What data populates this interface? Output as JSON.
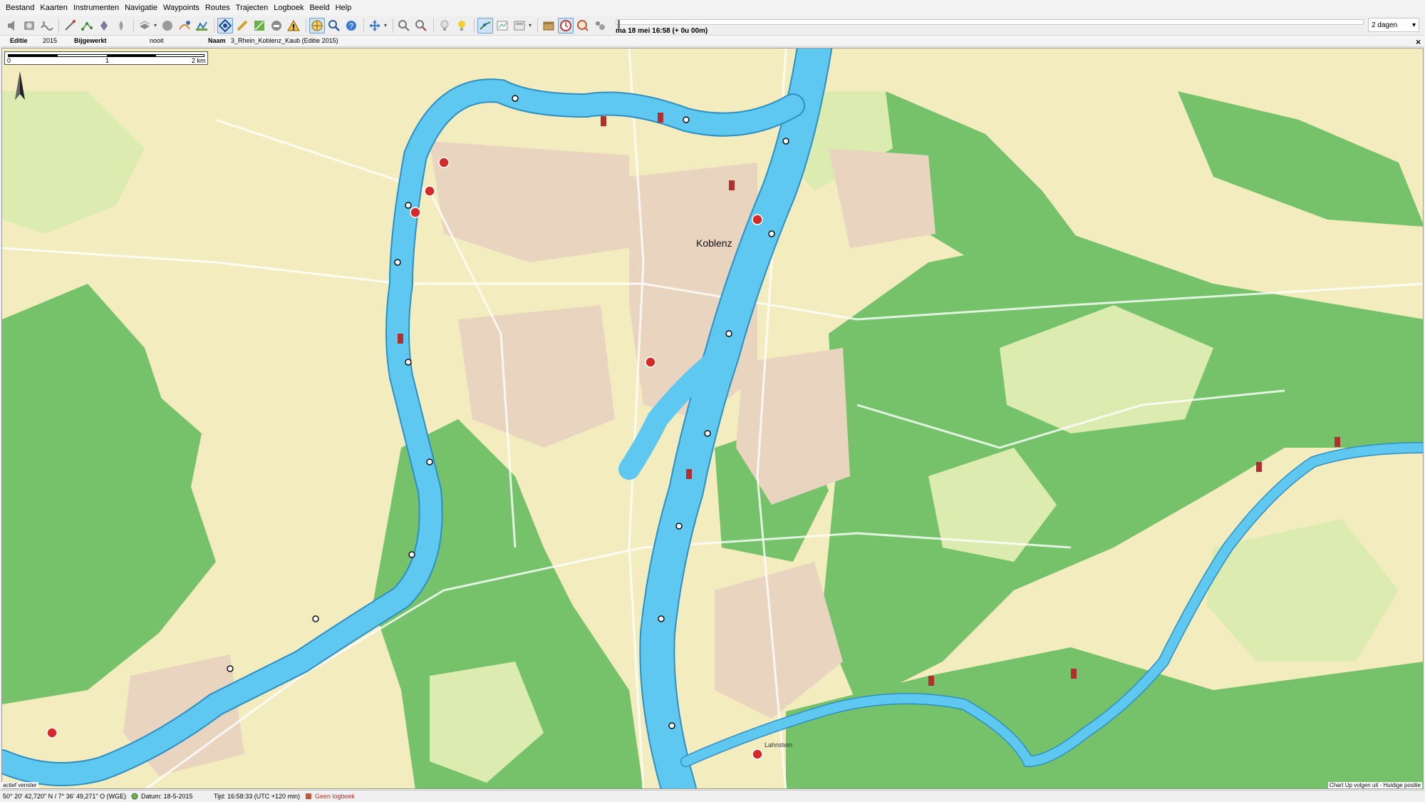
{
  "menu": [
    "Bestand",
    "Kaarten",
    "Instrumenten",
    "Navigatie",
    "Waypoints",
    "Routes",
    "Trajecten",
    "Logboek",
    "Beeld",
    "Help"
  ],
  "toolbar": {
    "icons": [
      "sound-icon",
      "instrument-icon",
      "route-icon",
      "tide-icon",
      "bearing-icon",
      "route-plan-icon",
      "waypoint-icon",
      "weather-icon",
      "layers-icon",
      "chart-icon",
      "north-up-icon",
      "night-mode-icon",
      "gps-icon",
      "warning-icon",
      "anchor-icon",
      "zoom-in-icon",
      "zoom-out-icon",
      "help-icon",
      "pan-icon",
      "measure-icon",
      "distance-icon",
      "track-icon",
      "light-icon",
      "graph-icon",
      "table-icon",
      "print-icon",
      "ruler-icon",
      "logbook-icon",
      "alarm-icon",
      "camera-icon"
    ],
    "time_label": "ma 18 mei 16:58  (+ 0u 00m)",
    "range": "2 dagen"
  },
  "chart_info": {
    "edition_label": "Editie",
    "edition_value": "2015",
    "updated_label": "Bijgewerkt",
    "updated_value": "nooit",
    "name_label": "Naam",
    "name_value": "3_Rhein_Koblenz_Kaub (Editie 2015)"
  },
  "map": {
    "city_label": "Koblenz",
    "place_labels": [
      "Lahnstein"
    ],
    "scale": {
      "start": "0",
      "mid": "1",
      "end": "2 km"
    },
    "colors": {
      "water": "#5ec8f0",
      "land": "#f3ecbe",
      "forest": "#75c26a",
      "field": "#dcebb0",
      "urban": "#e9d4c0"
    }
  },
  "overlay": {
    "active_window": "actief venster",
    "chart_status": "Chart Up volgen uit - Huidige positie"
  },
  "statusbar": {
    "position": "50° 20' 42,720\" N / 7° 36' 49,271\" O (WGE)",
    "date": "Datum: 18-5-2015",
    "time": "Tijd: 16:58:33 (UTC +120 min)",
    "logbook": "Geen logboek"
  }
}
